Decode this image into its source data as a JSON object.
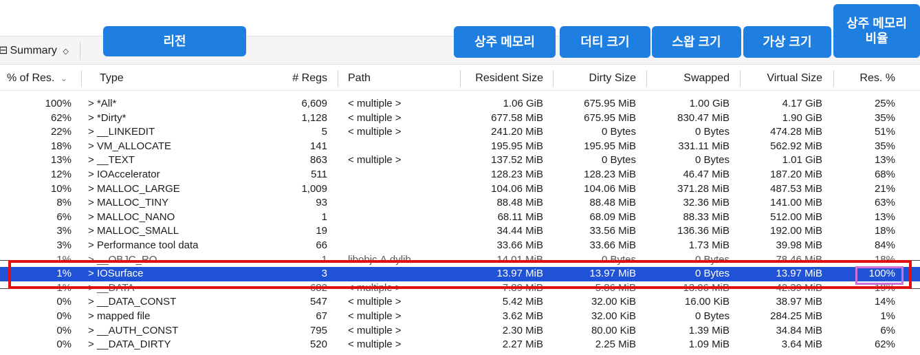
{
  "toolbar": {
    "summary_label": "Summary",
    "summary_icon": "grid-icon",
    "chevron": "⌃⌄"
  },
  "callouts": {
    "region": "리전",
    "resident": "상주 메모리",
    "dirty": "더티 크기",
    "swap": "스왑 크기",
    "virtual": "가상 크기",
    "res_ratio": "상주 메모리\n비율"
  },
  "columns": {
    "pct": "% of Res.",
    "type": "Type",
    "regs": "# Regs",
    "path": "Path",
    "resident": "Resident Size",
    "dirty": "Dirty Size",
    "swapped": "Swapped",
    "virtual": "Virtual Size",
    "res_pct": "Res. %"
  },
  "rows": [
    {
      "pct": "100%",
      "type": "*All*",
      "regs": "6,609",
      "path": "< multiple >",
      "resident": "1.06 GiB",
      "dirty": "675.95 MiB",
      "swapped": "1.00 GiB",
      "virtual": "4.17 GiB",
      "res_pct": "25%"
    },
    {
      "pct": "62%",
      "type": "*Dirty*",
      "regs": "1,128",
      "path": "< multiple >",
      "resident": "677.58 MiB",
      "dirty": "675.95 MiB",
      "swapped": "830.47 MiB",
      "virtual": "1.90 GiB",
      "res_pct": "35%"
    },
    {
      "pct": "22%",
      "type": "__LINKEDIT",
      "regs": "5",
      "path": "< multiple >",
      "resident": "241.20 MiB",
      "dirty": "0 Bytes",
      "swapped": "0 Bytes",
      "virtual": "474.28 MiB",
      "res_pct": "51%"
    },
    {
      "pct": "18%",
      "type": "VM_ALLOCATE",
      "regs": "141",
      "path": "",
      "resident": "195.95 MiB",
      "dirty": "195.95 MiB",
      "swapped": "331.11 MiB",
      "virtual": "562.92 MiB",
      "res_pct": "35%"
    },
    {
      "pct": "13%",
      "type": "__TEXT",
      "regs": "863",
      "path": "< multiple >",
      "resident": "137.52 MiB",
      "dirty": "0 Bytes",
      "swapped": "0 Bytes",
      "virtual": "1.01 GiB",
      "res_pct": "13%"
    },
    {
      "pct": "12%",
      "type": "IOAccelerator",
      "regs": "511",
      "path": "",
      "resident": "128.23 MiB",
      "dirty": "128.23 MiB",
      "swapped": "46.47 MiB",
      "virtual": "187.20 MiB",
      "res_pct": "68%"
    },
    {
      "pct": "10%",
      "type": "MALLOC_LARGE",
      "regs": "1,009",
      "path": "",
      "resident": "104.06 MiB",
      "dirty": "104.06 MiB",
      "swapped": "371.28 MiB",
      "virtual": "487.53 MiB",
      "res_pct": "21%"
    },
    {
      "pct": "8%",
      "type": "MALLOC_TINY",
      "regs": "93",
      "path": "",
      "resident": "88.48 MiB",
      "dirty": "88.48 MiB",
      "swapped": "32.36 MiB",
      "virtual": "141.00 MiB",
      "res_pct": "63%"
    },
    {
      "pct": "6%",
      "type": "MALLOC_NANO",
      "regs": "1",
      "path": "",
      "resident": "68.11 MiB",
      "dirty": "68.09 MiB",
      "swapped": "88.33 MiB",
      "virtual": "512.00 MiB",
      "res_pct": "13%"
    },
    {
      "pct": "3%",
      "type": "MALLOC_SMALL",
      "regs": "19",
      "path": "",
      "resident": "34.44 MiB",
      "dirty": "33.56 MiB",
      "swapped": "136.36 MiB",
      "virtual": "192.00 MiB",
      "res_pct": "18%"
    },
    {
      "pct": "3%",
      "type": "Performance tool data",
      "regs": "66",
      "path": "",
      "resident": "33.66 MiB",
      "dirty": "33.66 MiB",
      "swapped": "1.73 MiB",
      "virtual": "39.98 MiB",
      "res_pct": "84%"
    },
    {
      "pct": "1%",
      "type": "__OBJC_RO",
      "regs": "1",
      "path": "libobjc.A.dylib",
      "resident": "14.01 MiB",
      "dirty": "0 Bytes",
      "swapped": "0 Bytes",
      "virtual": "78.46 MiB",
      "res_pct": "18%",
      "style": "struck"
    },
    {
      "pct": "1%",
      "type": "IOSurface",
      "regs": "3",
      "path": "",
      "resident": "13.97 MiB",
      "dirty": "13.97 MiB",
      "swapped": "0 Bytes",
      "virtual": "13.97 MiB",
      "res_pct": "100%",
      "style": "sel"
    },
    {
      "pct": "1%",
      "type": "__DATA",
      "regs": "682",
      "path": "< multiple >",
      "resident": "7.89 MiB",
      "dirty": "5.86 MiB",
      "swapped": "13.06 MiB",
      "virtual": "42.39 MiB",
      "res_pct": "19%",
      "style": "struck"
    },
    {
      "pct": "0%",
      "type": "__DATA_CONST",
      "regs": "547",
      "path": "< multiple >",
      "resident": "5.42 MiB",
      "dirty": "32.00 KiB",
      "swapped": "16.00 KiB",
      "virtual": "38.97 MiB",
      "res_pct": "14%"
    },
    {
      "pct": "0%",
      "type": "mapped file",
      "regs": "67",
      "path": "< multiple >",
      "resident": "3.62 MiB",
      "dirty": "32.00 KiB",
      "swapped": "0 Bytes",
      "virtual": "284.25 MiB",
      "res_pct": "1%"
    },
    {
      "pct": "0%",
      "type": "__AUTH_CONST",
      "regs": "795",
      "path": "< multiple >",
      "resident": "2.30 MiB",
      "dirty": "80.00 KiB",
      "swapped": "1.39 MiB",
      "virtual": "34.84 MiB",
      "res_pct": "6%"
    },
    {
      "pct": "0%",
      "type": "__DATA_DIRTY",
      "regs": "520",
      "path": "< multiple >",
      "resident": "2.27 MiB",
      "dirty": "2.25 MiB",
      "swapped": "1.09 MiB",
      "virtual": "3.64 MiB",
      "res_pct": "62%"
    }
  ],
  "colors": {
    "callout": "#1f7fe0",
    "selection": "#2052d6",
    "highlight_border": "#e01010",
    "pct_box": "#d070d8"
  }
}
